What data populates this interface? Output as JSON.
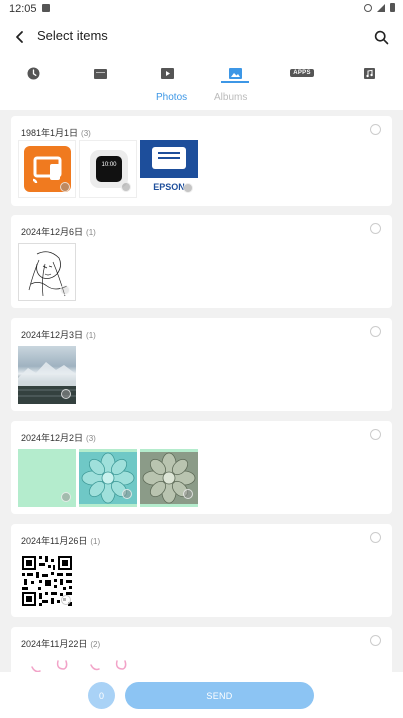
{
  "status_bar": {
    "time": "12:05"
  },
  "header": {
    "title": "Select items"
  },
  "categories": [
    {
      "name": "recent",
      "icon": "clock-icon"
    },
    {
      "name": "files",
      "icon": "folder-icon"
    },
    {
      "name": "videos",
      "icon": "video-icon"
    },
    {
      "name": "images",
      "icon": "image-icon",
      "selected": true
    },
    {
      "name": "apps",
      "icon": "apps-icon",
      "label": "APPS"
    },
    {
      "name": "music",
      "icon": "music-icon"
    }
  ],
  "subtabs": {
    "photos": "Photos",
    "albums": "Albums",
    "active": "photos"
  },
  "groups": [
    {
      "date": "1981年1月1日",
      "count": "(3)",
      "thumbs": [
        "cast-app-icon",
        "watch-app-icon",
        "epson-app-icon"
      ]
    },
    {
      "date": "2024年12月6日",
      "count": "(1)",
      "thumbs": [
        "sketch-drawing"
      ]
    },
    {
      "date": "2024年12月3日",
      "count": "(1)",
      "thumbs": [
        "mountain-photo"
      ]
    },
    {
      "date": "2024年12月2日",
      "count": "(3)",
      "thumbs": [
        "green-blank",
        "succulent-teal",
        "succulent-gray"
      ]
    },
    {
      "date": "2024年11月26日",
      "count": "(1)",
      "thumbs": [
        "qr-code"
      ]
    },
    {
      "date": "2024年11月22日",
      "count": "(2)",
      "thumbs": [
        "pink-doodle",
        "pink-doodle-2"
      ]
    }
  ],
  "thumb_text": {
    "watch_time": "10:00",
    "epson_label": "EPSON"
  },
  "footer": {
    "selected_count": "0",
    "send_label": "SEND"
  },
  "colors": {
    "accent": "#3d97e6",
    "send_button": "#8cc4f3",
    "count_badge": "#a9d2f6"
  }
}
